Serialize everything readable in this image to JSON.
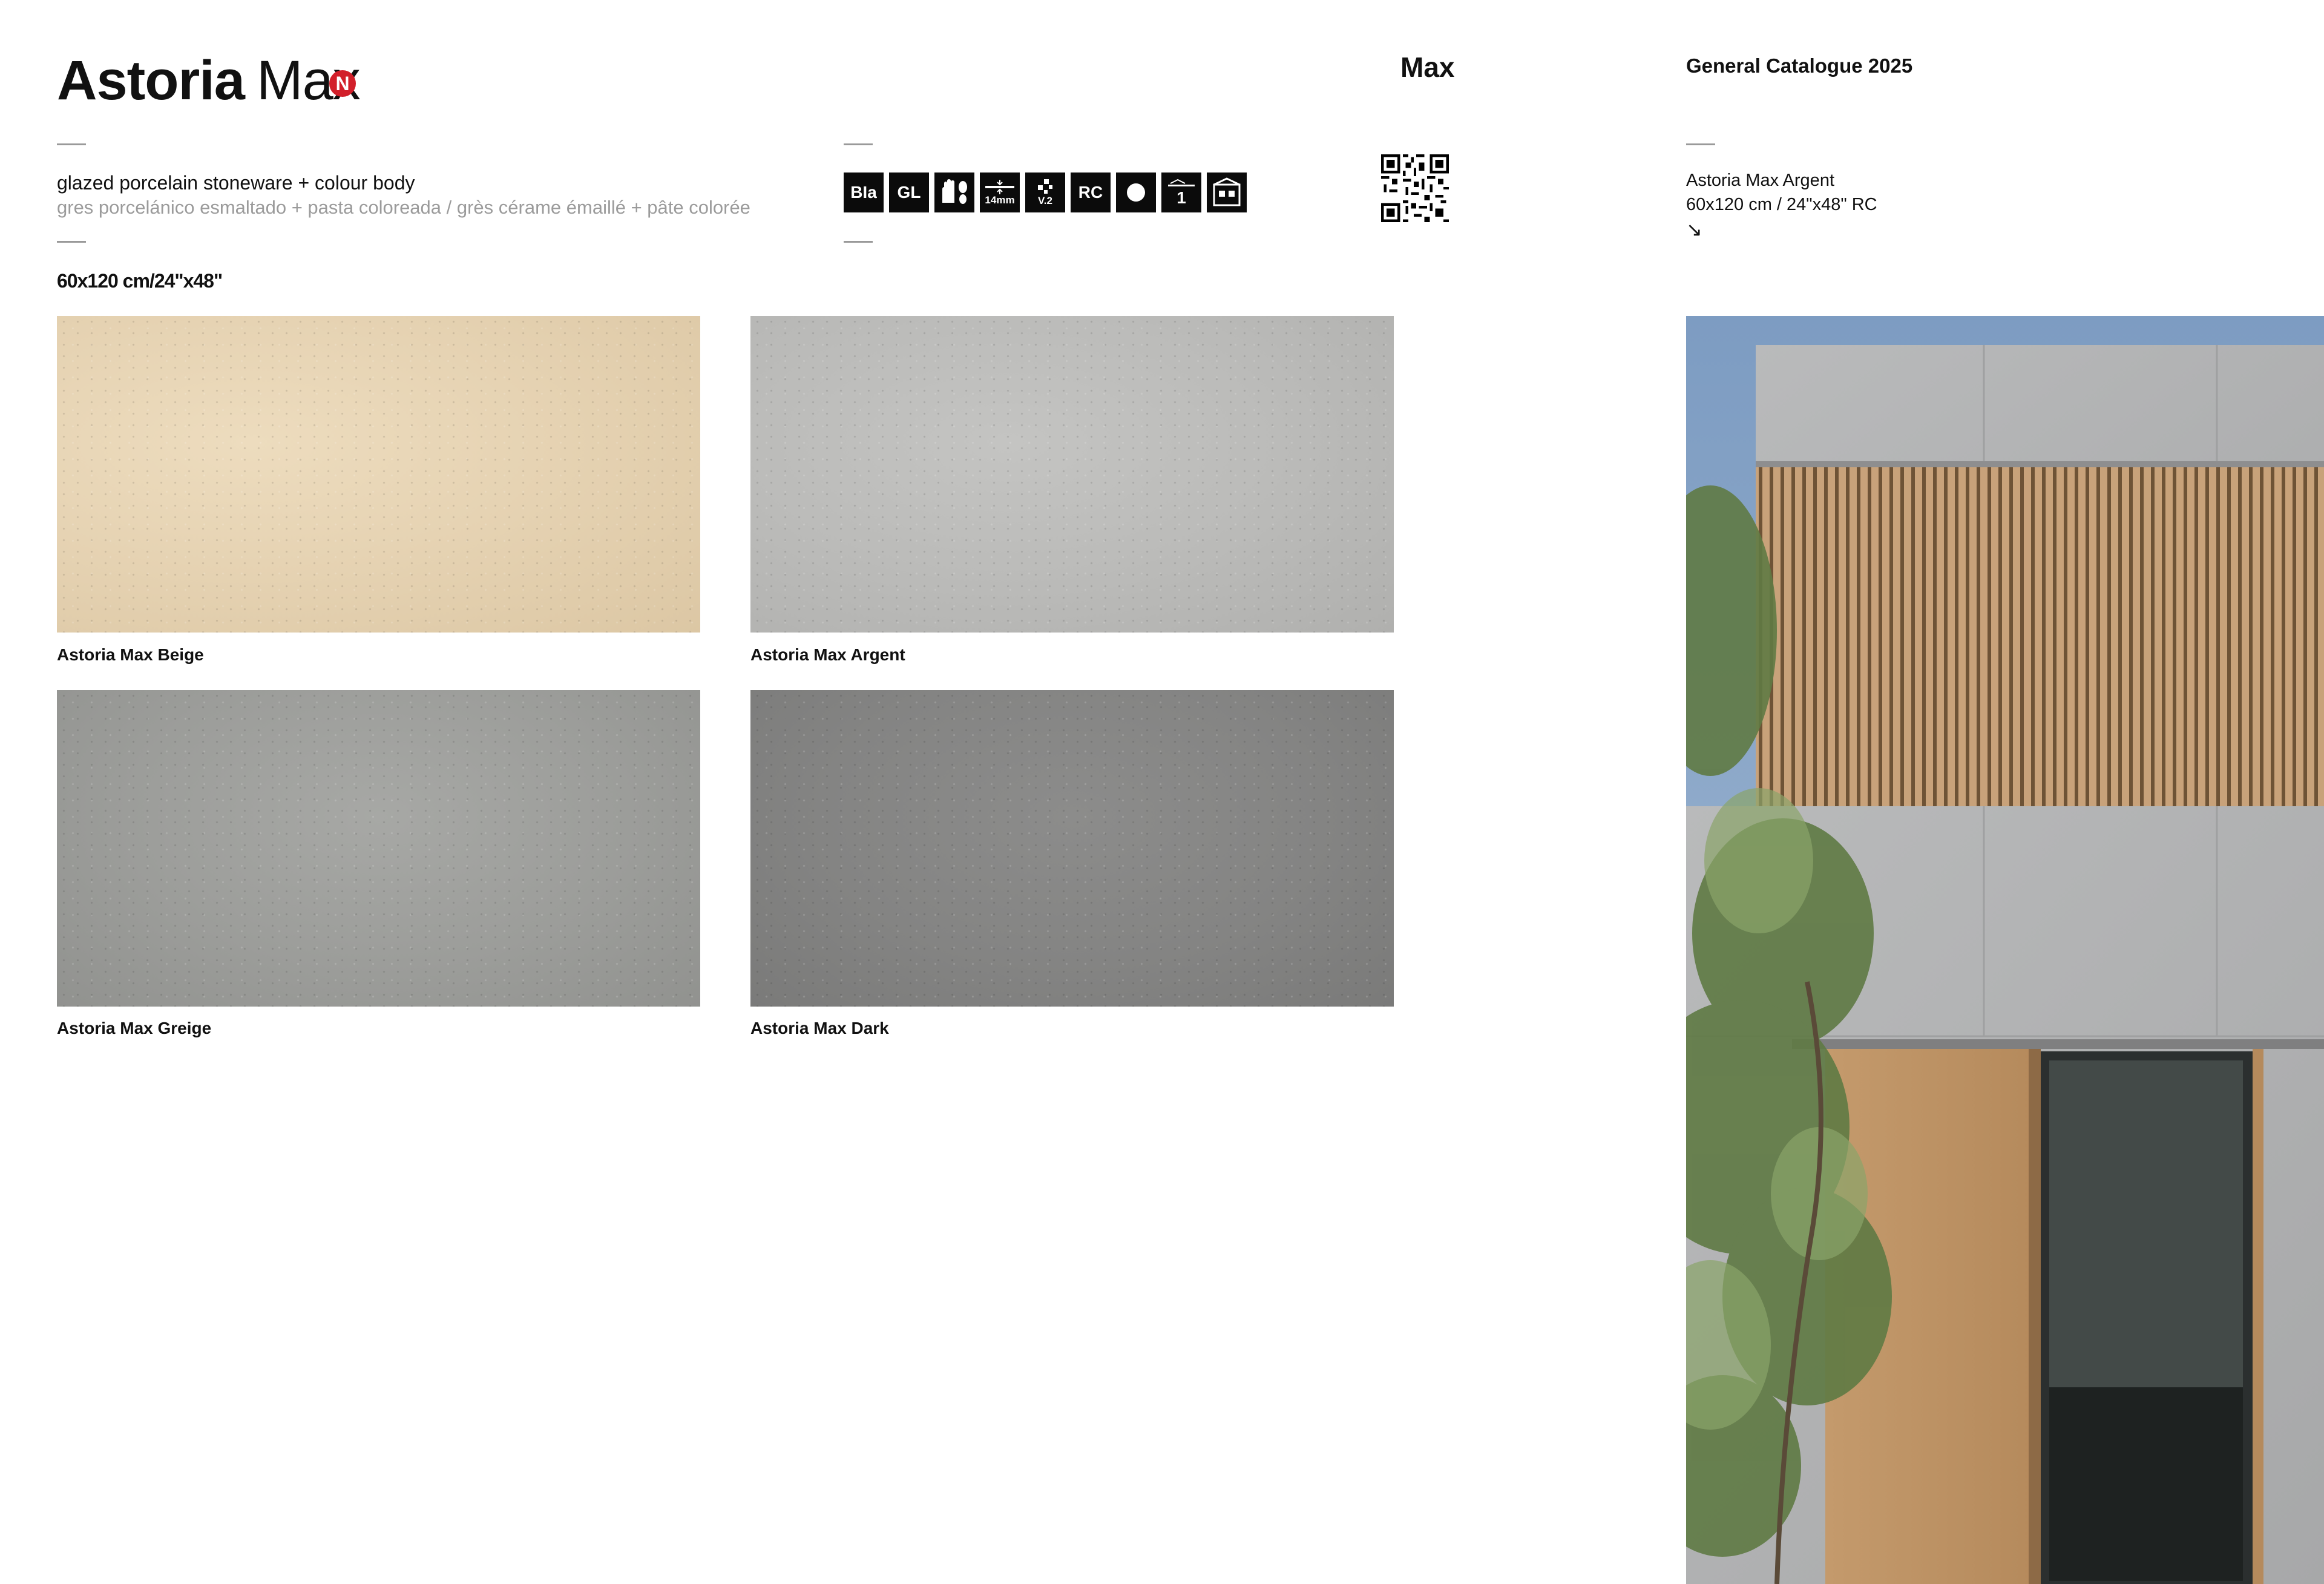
{
  "header": {
    "title_bold": "Astoria",
    "title_light": "Max",
    "new_badge": "N",
    "series": "Max",
    "catalogue": "General Catalogue 2025"
  },
  "description": {
    "main": "glazed porcelain stoneware + colour body",
    "sub": "gres porcelánico esmaltado + pasta coloreada / grès cérame émaillé + pâte colorée"
  },
  "size_label": "60x120 cm/24\"x48\"",
  "icons": [
    {
      "name": "bla-icon",
      "label": "BIa"
    },
    {
      "name": "gl-icon",
      "label": "GL"
    },
    {
      "name": "hand-foot-icon",
      "label": ""
    },
    {
      "name": "thickness-icon",
      "label": "14mm"
    },
    {
      "name": "variation-icon",
      "label": "V.2"
    },
    {
      "name": "rc-icon",
      "label": "RC"
    },
    {
      "name": "matt-finish-icon",
      "label": ""
    },
    {
      "name": "single-piece-icon",
      "label": "1"
    },
    {
      "name": "usage-icon",
      "label": ""
    }
  ],
  "reference": {
    "name": "Astoria Max Argent",
    "size": "60x120 cm / 24\"x48\" RC",
    "arrow": "↘"
  },
  "tiles": [
    {
      "label": "Astoria Max Beige",
      "color": "#e6d3b3"
    },
    {
      "label": "Astoria Max Argent",
      "color": "#bbbbb9"
    },
    {
      "label": "Astoria Max Greige",
      "color": "#9c9d9a"
    },
    {
      "label": "Astoria Max Dark",
      "color": "#848483"
    }
  ]
}
